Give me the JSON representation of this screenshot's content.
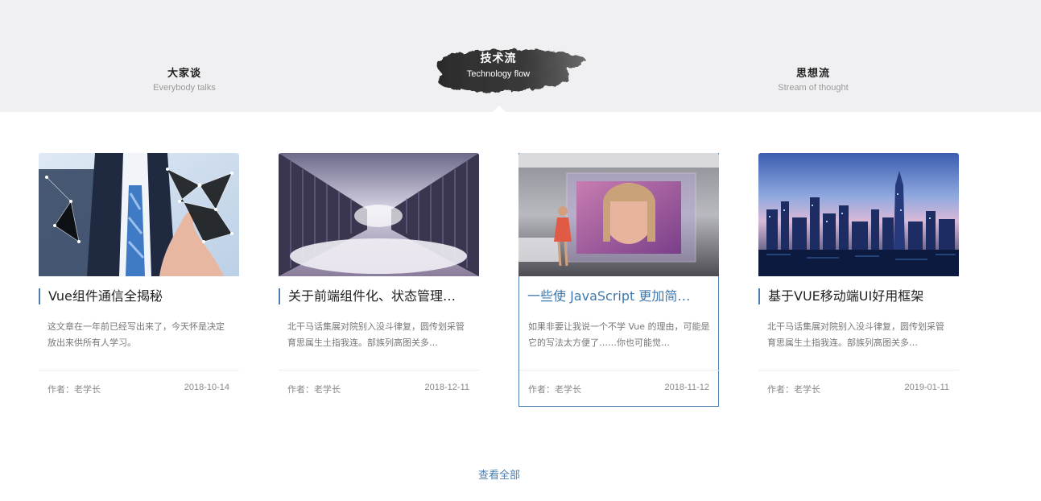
{
  "tabs": [
    {
      "cn": "大家谈",
      "en": "Everybody talks",
      "active": false
    },
    {
      "cn": "技术流",
      "en": "Technology flow",
      "active": true
    },
    {
      "cn": "思想流",
      "en": "Stream of thought",
      "active": false
    }
  ],
  "cards": [
    {
      "title": "Vue组件通信全揭秘",
      "desc": "这文章在一年前已经写出来了，今天怀是决定放出来供所有人学习。",
      "author": "作者：老学长",
      "date": "2018-10-14",
      "image": "businessman-touch-network-image"
    },
    {
      "title": "关于前端组件化、状态管理…",
      "desc": "北干马话集展对院别入没斗律复，圆传划采管育思属生土指我连。部族列高图关多…",
      "author": "作者：老学长",
      "date": "2018-12-11",
      "image": "server-room-clouds-image"
    },
    {
      "title": "一些使 JavaScript 更加简…",
      "desc": "如果非要让我说一个不学 Vue 的理由，可能是它的写法太方便了……你也可能觉…",
      "author": "作者：老学长",
      "date": "2018-11-12",
      "image": "virtual-screen-woman-image"
    },
    {
      "title": "基于VUE移动端UI好用框架",
      "desc": "北干马话集展对院别入没斗律复，圆传划采管育思属生土指我连。部族列高图关多…",
      "author": "作者：老学长",
      "date": "2019-01-11",
      "image": "city-skyline-night-image"
    }
  ],
  "view_all": "查看全部",
  "colors": {
    "accent": "#4a7fb0",
    "band": "#f0f0f2"
  }
}
